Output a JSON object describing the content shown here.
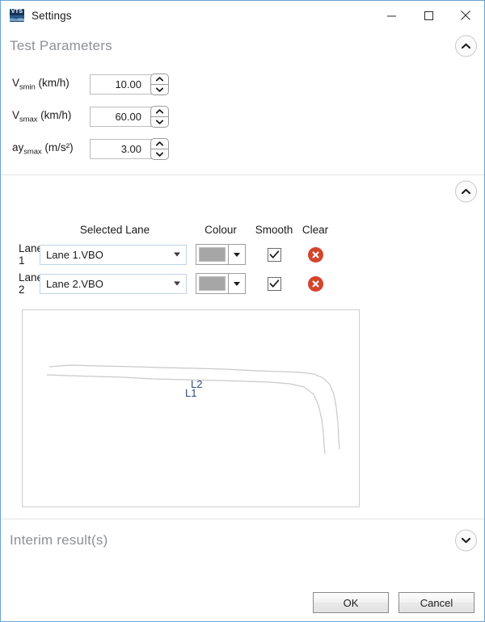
{
  "window": {
    "title": "Settings",
    "app_icon": "vts-app-icon",
    "icon_text": "VTS",
    "controls": {
      "minimize": "minimize-icon",
      "maximize": "maximize-icon",
      "close": "close-icon"
    },
    "border_color": "#6ba3d6"
  },
  "sections": {
    "test_parameters": {
      "title": "Test Parameters",
      "collapse_icon": "chevron-up-icon",
      "parameters": [
        {
          "symbol": "V",
          "subscript": "smin",
          "unit": "(km/h)",
          "value": "10.00"
        },
        {
          "symbol": "V",
          "subscript": "smax",
          "unit": "(km/h)",
          "value": "60.00"
        },
        {
          "symbol": "ay",
          "subscript": "smax",
          "unit": "(m/s²)",
          "value": "3.00"
        }
      ]
    },
    "lanes": {
      "title": "",
      "collapse_icon": "chevron-up-icon",
      "columns": [
        "",
        "Selected Lane",
        "Colour",
        "Smooth",
        "Clear"
      ],
      "rows": [
        {
          "name": "Lane 1",
          "selected_lane": "Lane 1.VBO",
          "colour": "#a6a6a6",
          "smooth": true,
          "clear_icon": "clear-circle-icon"
        },
        {
          "name": "Lane 2",
          "selected_lane": "Lane 2.VBO",
          "colour": "#a6a6a6",
          "smooth": true,
          "clear_icon": "clear-circle-icon"
        }
      ]
    },
    "interim_results": {
      "title": "Interim result(s)",
      "expand_icon": "chevron-down-icon"
    }
  },
  "chart_data": {
    "type": "line",
    "title": "",
    "xlabel": "",
    "ylabel": "",
    "grid": false,
    "legend": "inline-annotations",
    "annotations": [
      {
        "text": "L1",
        "x": 201,
        "y": 95,
        "color": "#2e4a7d"
      },
      {
        "text": "L2",
        "x": 208,
        "y": 84,
        "color": "#2e4a7d"
      }
    ],
    "series": [
      {
        "name": "L2",
        "color": "#c9c9c9",
        "points": [
          [
            33,
            70
          ],
          [
            60,
            68
          ],
          [
            95,
            69
          ],
          [
            140,
            70
          ],
          [
            170,
            71
          ],
          [
            215,
            72
          ],
          [
            250,
            73
          ],
          [
            290,
            75
          ],
          [
            320,
            76
          ],
          [
            345,
            77
          ],
          [
            360,
            79
          ],
          [
            372,
            84
          ],
          [
            380,
            92
          ],
          [
            385,
            104
          ],
          [
            388,
            120
          ],
          [
            390,
            140
          ],
          [
            391,
            160
          ],
          [
            392,
            172
          ]
        ]
      },
      {
        "name": "L1",
        "color": "#c9c9c9",
        "points": [
          [
            30,
            80
          ],
          [
            55,
            81
          ],
          [
            90,
            82
          ],
          [
            125,
            83
          ],
          [
            160,
            85
          ],
          [
            200,
            86
          ],
          [
            240,
            87
          ],
          [
            275,
            88
          ],
          [
            305,
            89
          ],
          [
            330,
            91
          ],
          [
            348,
            95
          ],
          [
            360,
            104
          ],
          [
            366,
            118
          ],
          [
            370,
            135
          ],
          [
            372,
            152
          ],
          [
            373,
            168
          ],
          [
            374,
            178
          ]
        ]
      }
    ],
    "xlim": [
      0,
      418
    ],
    "ylim": [
      0,
      245
    ]
  },
  "footer": {
    "ok_label": "OK",
    "cancel_label": "Cancel"
  }
}
